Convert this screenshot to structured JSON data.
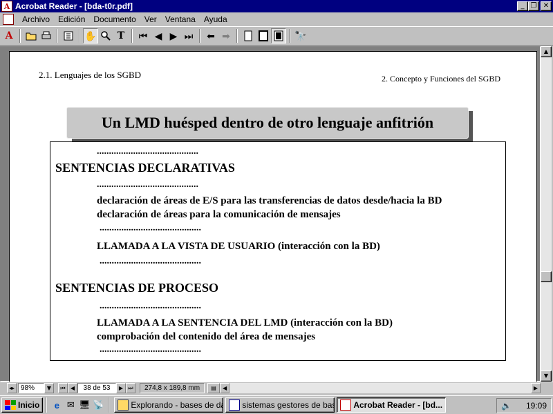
{
  "window": {
    "title": "Acrobat Reader - [bda-t0r.pdf]",
    "app_icon": "acrobat-icon",
    "buttons": [
      "_",
      "❐",
      "✕"
    ]
  },
  "menu": {
    "items": [
      "Archivo",
      "Edición",
      "Documento",
      "Ver",
      "Ventana",
      "Ayuda"
    ],
    "doc_buttons": [
      "_",
      "❐",
      "✕"
    ]
  },
  "toolbar": {
    "icons": [
      "acrobat-logo-icon",
      "open-icon",
      "print-icon",
      "page-only-icon",
      "hand-tool-icon",
      "zoom-tool-icon",
      "text-select-icon",
      "first-page-icon",
      "previous-page-icon",
      "next-page-icon",
      "last-page-icon",
      "go-back-icon",
      "go-forward-icon",
      "actual-size-icon",
      "fit-page-icon",
      "fit-width-icon",
      "find-icon"
    ]
  },
  "document": {
    "header_left": "2.1. Lenguajes de los SGBD",
    "header_right": "2. Concepto y Funciones del SGBD",
    "title": "Un LMD huésped dentro de otro lenguaje anfitrión",
    "dots": "..........................................",
    "section1": "SENTENCIAS DECLARATIVAS",
    "decl_1": "declaración de áreas de E/S para las transferencias de datos desde/hacia la BD",
    "decl_2": "declaración de áreas para la comunicación de mensajes",
    "call_view": "LLAMADA A LA VISTA DE USUARIO (interacción con la BD)",
    "section2": "SENTENCIAS DE PROCESO",
    "call_stmt": "LLAMADA A LA SENTENCIA DEL LMD (interacción con la BD)",
    "check_msg": "comprobación del contenido del área de mensajes"
  },
  "status": {
    "zoom": "98%",
    "page": "38 de 53",
    "dimensions": "274,8 x 189,8  mm"
  },
  "taskbar": {
    "start_label": "Inicio",
    "tasks": [
      "Explorando - bases de datos",
      "sistemas gestores de base...",
      "Acrobat Reader - [bd..."
    ],
    "clock": "19:09"
  },
  "colors": {
    "titlebar": "#000080",
    "face": "#c0c0c0",
    "acrobat_red": "#c00000"
  }
}
